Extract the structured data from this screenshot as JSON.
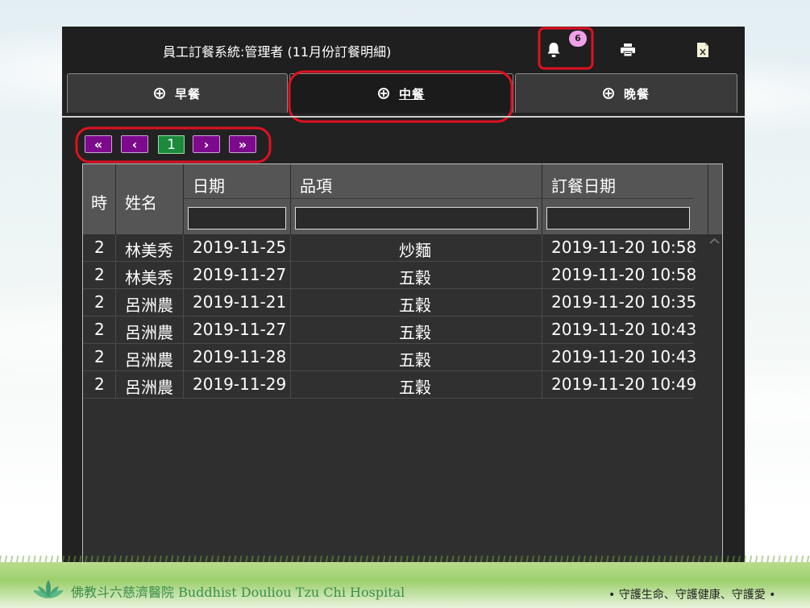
{
  "header": {
    "title": "員工訂餐系統:管理者 (11月份訂餐明細)",
    "notification_count": "6",
    "icons": [
      "bell-icon",
      "print-icon",
      "excel-icon"
    ]
  },
  "tabs": [
    {
      "label": "早餐",
      "active": false
    },
    {
      "label": "中餐",
      "active": true
    },
    {
      "label": "晚餐",
      "active": false
    }
  ],
  "pager": {
    "first": "«",
    "prev": "‹",
    "current": "1",
    "next": "›",
    "last": "»"
  },
  "grid": {
    "columns": [
      "時",
      "姓名",
      "日期",
      "品項",
      "訂餐日期"
    ],
    "filters": {
      "date": "",
      "item": "",
      "order_date": ""
    },
    "rows": [
      {
        "time": "2",
        "name": "林美秀",
        "date": "2019-11-25",
        "item": "炒麵",
        "order_date": "2019-11-20 10:58"
      },
      {
        "time": "2",
        "name": "林美秀",
        "date": "2019-11-27",
        "item": "五穀",
        "order_date": "2019-11-20 10:58"
      },
      {
        "time": "2",
        "name": "呂洲農",
        "date": "2019-11-21",
        "item": "五穀",
        "order_date": "2019-11-20 10:35"
      },
      {
        "time": "2",
        "name": "呂洲農",
        "date": "2019-11-27",
        "item": "五穀",
        "order_date": "2019-11-20 10:43"
      },
      {
        "time": "2",
        "name": "呂洲農",
        "date": "2019-11-28",
        "item": "五穀",
        "order_date": "2019-11-20 10:43"
      },
      {
        "time": "2",
        "name": "呂洲農",
        "date": "2019-11-29",
        "item": "五穀",
        "order_date": "2019-11-20 10:49"
      }
    ]
  },
  "footer": {
    "hospital": "佛教斗六慈濟醫院  Buddhist  Douliou Tzu Chi Hospital",
    "slogan": "• 守護生命、守護健康、守護愛 •"
  },
  "colors": {
    "app_bg": "#222222",
    "pager": "#7d0a8c",
    "pager_current": "#1b8a3a",
    "badge": "#f0a0e8",
    "highlight": "#e01020"
  }
}
